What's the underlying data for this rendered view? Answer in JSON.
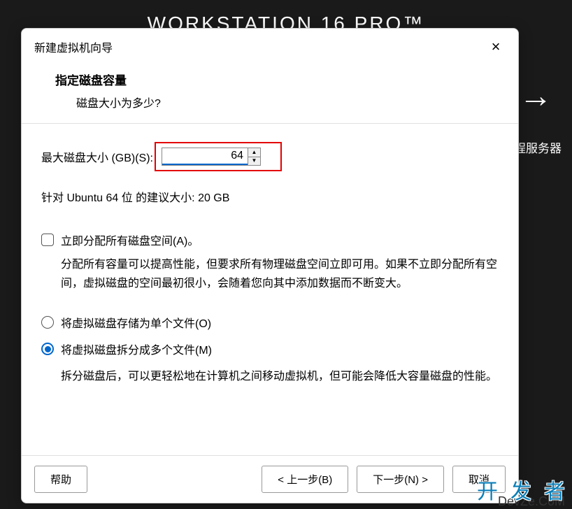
{
  "background": {
    "app_title": "WORKSTATION 16 PRO™",
    "arrow": "→",
    "server_text": "程服务器",
    "watermark_chars": [
      "开",
      "发",
      "者"
    ],
    "devze": "DevZe.CoM"
  },
  "dialog": {
    "title": "新建虚拟机向导",
    "close": "×",
    "header_title": "指定磁盘容量",
    "header_sub": "磁盘大小为多少?",
    "size_label": "最大磁盘大小 (GB)(S):",
    "size_value": "64",
    "recommend_text": "针对 Ubuntu 64 位 的建议大小: 20 GB",
    "checkbox_label": "立即分配所有磁盘空间(A)。",
    "checkbox_desc": "分配所有容量可以提高性能，但要求所有物理磁盘空间立即可用。如果不立即分配所有空间，虚拟磁盘的空间最初很小，会随着您向其中添加数据而不断变大。",
    "radio_single_label": "将虚拟磁盘存储为单个文件(O)",
    "radio_split_label": "将虚拟磁盘拆分成多个文件(M)",
    "radio_split_desc": "拆分磁盘后，可以更轻松地在计算机之间移动虚拟机，但可能会降低大容量磁盘的性能。",
    "buttons": {
      "help": "帮助",
      "back": "< 上一步(B)",
      "next": "下一步(N) >",
      "cancel": "取消"
    }
  }
}
